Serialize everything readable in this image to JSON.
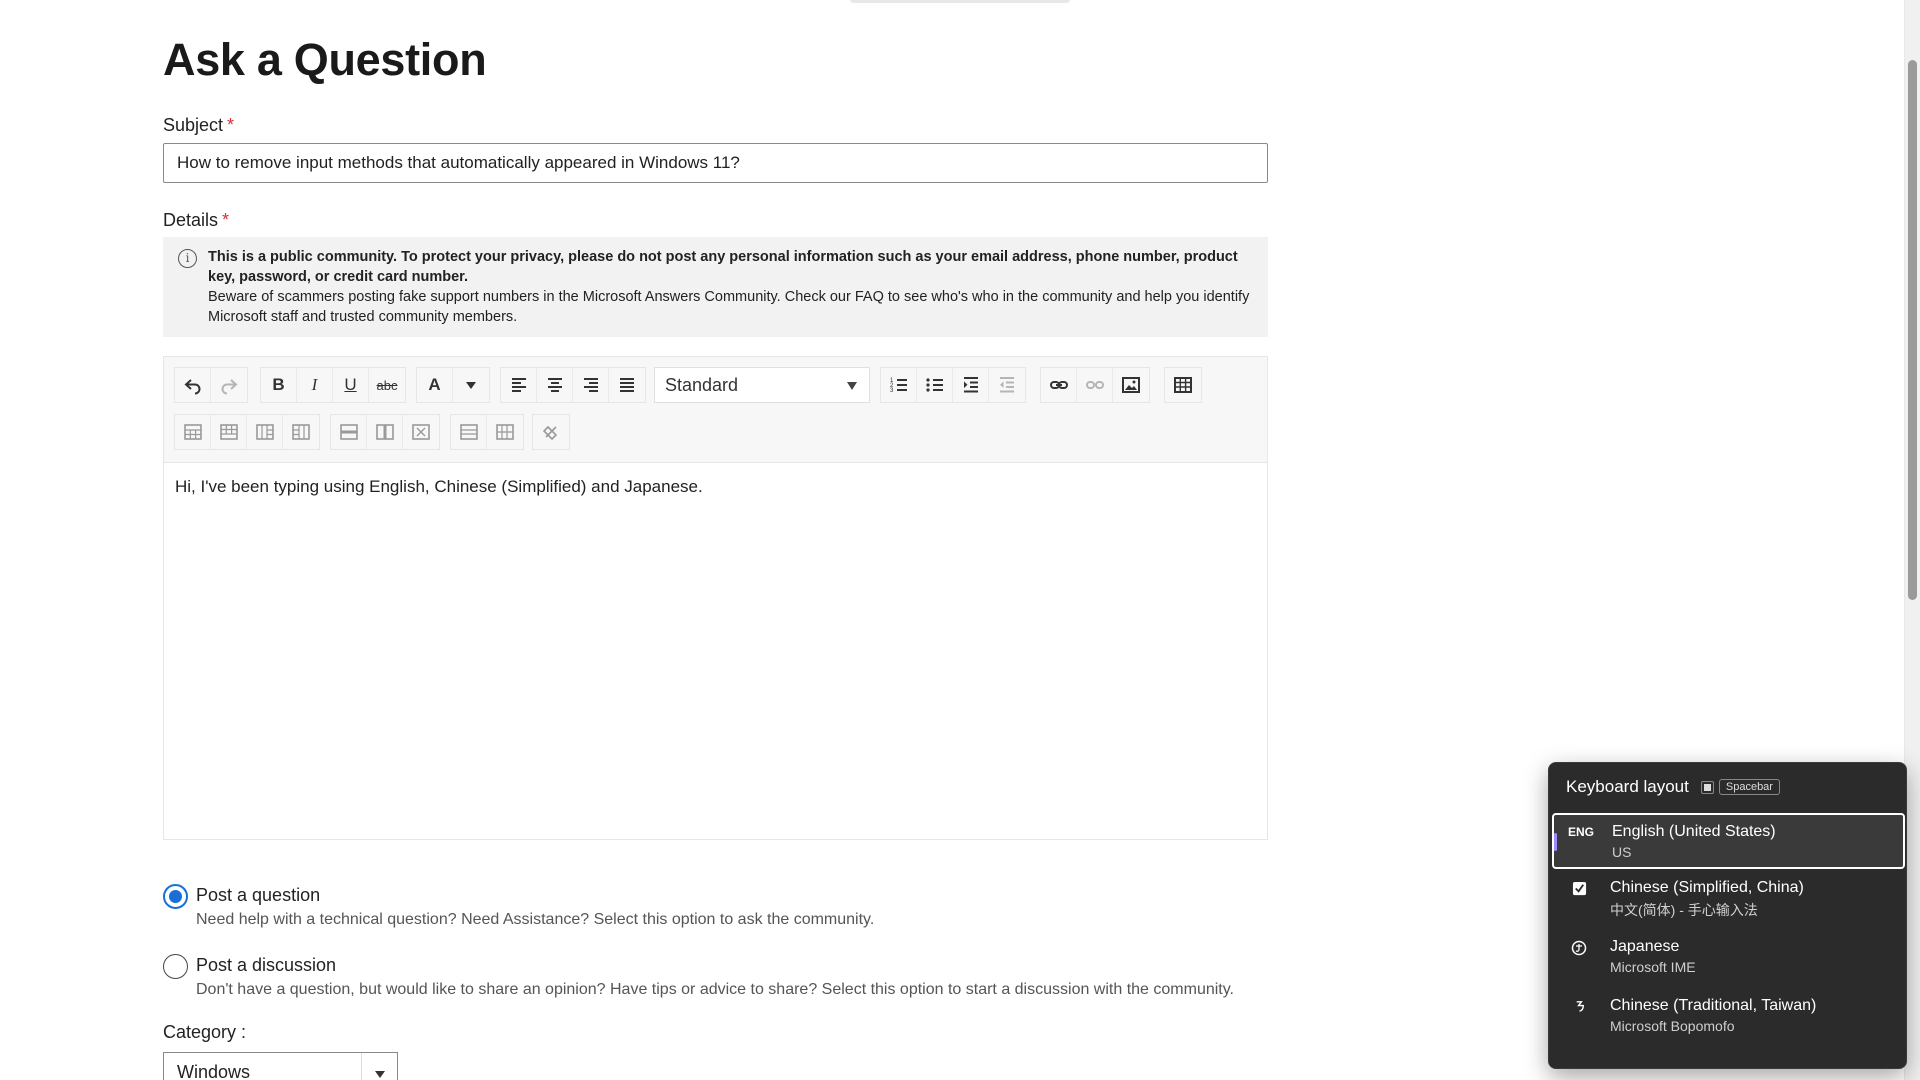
{
  "page": {
    "title": "Ask a Question"
  },
  "subject": {
    "label": "Subject",
    "required_mark": "*",
    "value": "How to remove input methods that automatically appeared in Windows 11?"
  },
  "details": {
    "label": "Details",
    "required_mark": "*",
    "notice_bold": "This is a public community. To protect your privacy, please do not post any personal information such as your email address, phone number, product key, password, or credit card number.",
    "notice_text": "Beware of scammers posting fake support numbers in the Microsoft Answers Community.  Check our FAQ to see who's who in the community and help you identify Microsoft staff and trusted community members."
  },
  "editor": {
    "format_value": "Standard",
    "body_text": "Hi, I've been typing using English, Chinese (Simplified) and Japanese.",
    "toolbar_icons": {
      "undo": "undo-icon",
      "redo": "redo-icon",
      "bold": "B",
      "italic": "I",
      "underline": "U",
      "strike": "abc",
      "font_color": "A"
    }
  },
  "post_type": {
    "question_title": "Post a question",
    "question_desc": "Need help with a technical question? Need Assistance? Select this option to ask the community.",
    "discussion_title": "Post a discussion",
    "discussion_desc": "Don't have a question, but would like to share an opinion? Have tips or advice to share? Select this option to start a discussion with the community.",
    "selected": "question"
  },
  "category": {
    "label": "Category :",
    "value": "Windows"
  },
  "keyboard_flyout": {
    "title": "Keyboard layout",
    "hint": "Spacebar",
    "items": [
      {
        "icon": "ENG",
        "name": "English (United States)",
        "sub": "US",
        "selected": true
      },
      {
        "icon": "chinese-simplified-ime-icon",
        "name": "Chinese (Simplified, China)",
        "sub": "中文(简体) - 手心输入法",
        "selected": false
      },
      {
        "icon": "japanese-ime-icon",
        "name": "Japanese",
        "sub": "Microsoft IME",
        "selected": false
      },
      {
        "icon": "bopomofo-ime-icon",
        "name": "Chinese (Traditional, Taiwan)",
        "sub": "Microsoft Bopomofo",
        "selected": false
      }
    ]
  },
  "colors": {
    "accent": "#1a6fd6",
    "required": "#d13438",
    "flyout_bg": "#2b2b2b",
    "flyout_accent": "#9b8cff"
  }
}
